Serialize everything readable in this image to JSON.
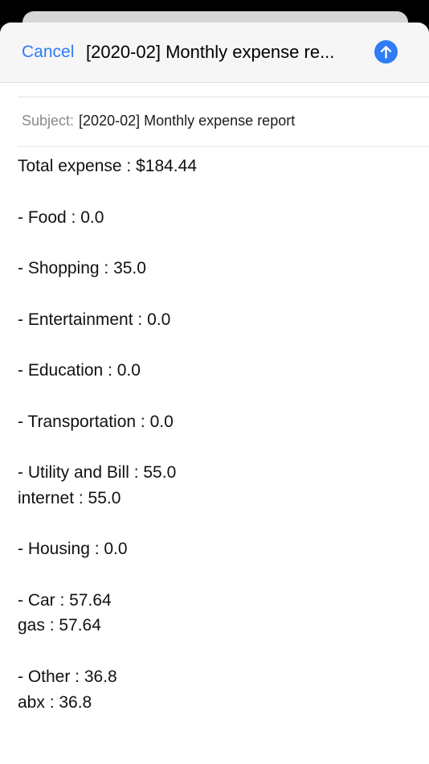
{
  "nav": {
    "cancel_label": "Cancel",
    "title": "[2020-02] Monthly expense re...",
    "send_icon": "arrow-up-icon",
    "accent_color": "#2f7cf6"
  },
  "subject": {
    "label": "Subject:",
    "value": "[2020-02] Monthly expense report"
  },
  "body": {
    "total": "Total expense : $184.44",
    "food": "- Food : 0.0",
    "shopping": "- Shopping : 35.0",
    "entertainment": "- Entertainment : 0.0",
    "education": "- Education : 0.0",
    "transportation": "- Transportation : 0.0",
    "utility": "- Utility and Bill : 55.0",
    "utility_internet": "internet : 55.0",
    "housing": "- Housing : 0.0",
    "car": "- Car : 57.64",
    "car_gas": "gas : 57.64",
    "other": "- Other : 36.8",
    "other_abx": "abx : 36.8"
  }
}
